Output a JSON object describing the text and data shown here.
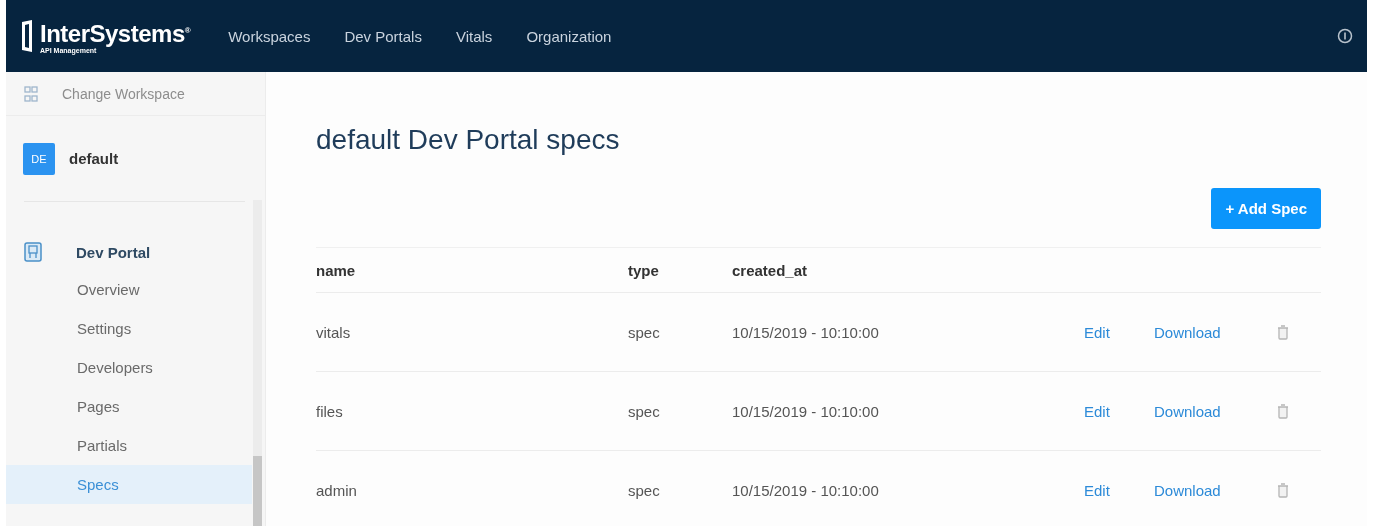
{
  "header": {
    "brand": {
      "name": "InterSystems$^{®}$",
      "subtitle": "API Management"
    },
    "nav": [
      {
        "label": "Workspaces"
      },
      {
        "label": "Dev Portals"
      },
      {
        "label": "Vitals"
      },
      {
        "label": "Organization"
      }
    ]
  },
  "sidebar": {
    "change_workspace": "Change Workspace",
    "workspace": {
      "badge": "DE",
      "name": "default"
    },
    "section": "Dev Portal",
    "items": [
      {
        "label": "Overview",
        "selected": false
      },
      {
        "label": "Settings",
        "selected": false
      },
      {
        "label": "Developers",
        "selected": false
      },
      {
        "label": "Pages",
        "selected": false
      },
      {
        "label": "Partials",
        "selected": false
      },
      {
        "label": "Specs",
        "selected": true
      }
    ]
  },
  "main": {
    "title": "default Dev Portal specs",
    "add_button": "+ Add Spec",
    "table": {
      "columns": [
        "name",
        "type",
        "created_at"
      ],
      "rows": [
        {
          "name": "vitals",
          "type": "spec",
          "created_at": "10/15/2019 - 10:10:00",
          "edit": "Edit",
          "download": "Download"
        },
        {
          "name": "files",
          "type": "spec",
          "created_at": "10/15/2019 - 10:10:00",
          "edit": "Edit",
          "download": "Download"
        },
        {
          "name": "admin",
          "type": "spec",
          "created_at": "10/15/2019 - 10:10:00",
          "edit": "Edit",
          "download": "Download"
        }
      ]
    }
  }
}
